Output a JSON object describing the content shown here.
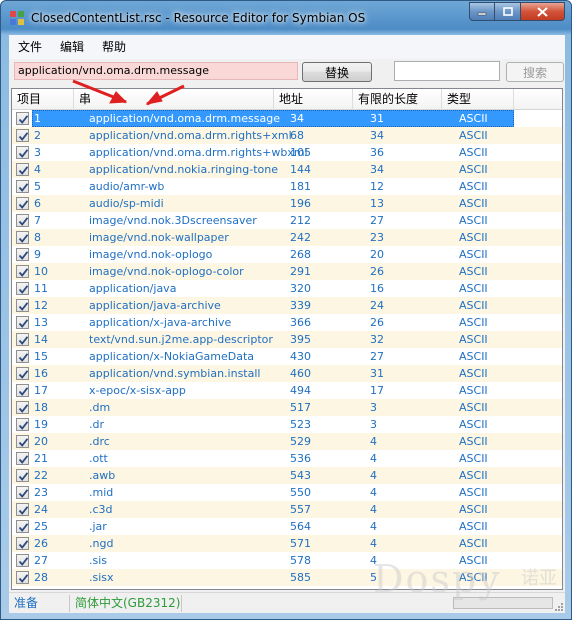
{
  "window": {
    "title": "ClosedContentList.rsc - Resource Editor for Symbian OS"
  },
  "menu": [
    "文件",
    "编辑",
    "帮助"
  ],
  "toolbar": {
    "path_value": "application/vnd.oma.drm.message",
    "replace_label": "替换",
    "search_value": "",
    "search_label": "搜索"
  },
  "columns": [
    "项目",
    "串",
    "地址",
    "有限的长度",
    "类型"
  ],
  "rows": [
    {
      "n": "1",
      "s": "application/vnd.oma.drm.message",
      "a": "34",
      "l": "31",
      "t": "ASCII"
    },
    {
      "n": "2",
      "s": "application/vnd.oma.drm.rights+xml",
      "a": "68",
      "l": "34",
      "t": "ASCII"
    },
    {
      "n": "3",
      "s": "application/vnd.oma.drm.rights+wbxml",
      "a": "105",
      "l": "36",
      "t": "ASCII"
    },
    {
      "n": "4",
      "s": "application/vnd.nokia.ringing-tone",
      "a": "144",
      "l": "34",
      "t": "ASCII"
    },
    {
      "n": "5",
      "s": "audio/amr-wb",
      "a": "181",
      "l": "12",
      "t": "ASCII"
    },
    {
      "n": "6",
      "s": "audio/sp-midi",
      "a": "196",
      "l": "13",
      "t": "ASCII"
    },
    {
      "n": "7",
      "s": "image/vnd.nok.3Dscreensaver",
      "a": "212",
      "l": "27",
      "t": "ASCII"
    },
    {
      "n": "8",
      "s": "image/vnd.nok-wallpaper",
      "a": "242",
      "l": "23",
      "t": "ASCII"
    },
    {
      "n": "9",
      "s": "image/vnd.nok-oplogo",
      "a": "268",
      "l": "20",
      "t": "ASCII"
    },
    {
      "n": "10",
      "s": "image/vnd.nok-oplogo-color",
      "a": "291",
      "l": "26",
      "t": "ASCII"
    },
    {
      "n": "11",
      "s": "application/java",
      "a": "320",
      "l": "16",
      "t": "ASCII"
    },
    {
      "n": "12",
      "s": "application/java-archive",
      "a": "339",
      "l": "24",
      "t": "ASCII"
    },
    {
      "n": "13",
      "s": "application/x-java-archive",
      "a": "366",
      "l": "26",
      "t": "ASCII"
    },
    {
      "n": "14",
      "s": "text/vnd.sun.j2me.app-descriptor",
      "a": "395",
      "l": "32",
      "t": "ASCII"
    },
    {
      "n": "15",
      "s": "application/x-NokiaGameData",
      "a": "430",
      "l": "27",
      "t": "ASCII"
    },
    {
      "n": "16",
      "s": "application/vnd.symbian.install",
      "a": "460",
      "l": "31",
      "t": "ASCII"
    },
    {
      "n": "17",
      "s": "x-epoc/x-sisx-app",
      "a": "494",
      "l": "17",
      "t": "ASCII"
    },
    {
      "n": "18",
      "s": ".dm",
      "a": "517",
      "l": "3",
      "t": "ASCII"
    },
    {
      "n": "19",
      "s": ".dr",
      "a": "523",
      "l": "3",
      "t": "ASCII"
    },
    {
      "n": "20",
      "s": ".drc",
      "a": "529",
      "l": "4",
      "t": "ASCII"
    },
    {
      "n": "21",
      "s": ".ott",
      "a": "536",
      "l": "4",
      "t": "ASCII"
    },
    {
      "n": "22",
      "s": ".awb",
      "a": "543",
      "l": "4",
      "t": "ASCII"
    },
    {
      "n": "23",
      "s": ".mid",
      "a": "550",
      "l": "4",
      "t": "ASCII"
    },
    {
      "n": "24",
      "s": ".c3d",
      "a": "557",
      "l": "4",
      "t": "ASCII"
    },
    {
      "n": "25",
      "s": ".jar",
      "a": "564",
      "l": "4",
      "t": "ASCII"
    },
    {
      "n": "26",
      "s": ".ngd",
      "a": "571",
      "l": "4",
      "t": "ASCII"
    },
    {
      "n": "27",
      "s": ".sis",
      "a": "578",
      "l": "4",
      "t": "ASCII"
    },
    {
      "n": "28",
      "s": ".sisx",
      "a": "585",
      "l": "5",
      "t": "ASCII"
    }
  ],
  "selected_row": "1",
  "status": {
    "ready": "准备",
    "encoding": "简体中文(GB2312)"
  },
  "watermark": {
    "latin": "Dospy",
    "cn": "诺亚"
  },
  "colors": {
    "selection": "#3399ff",
    "row_alt": "#fdf6e2",
    "text_blue": "#1f6fc2",
    "path_bg": "#fbd8d8",
    "arrow": "#e02020"
  }
}
